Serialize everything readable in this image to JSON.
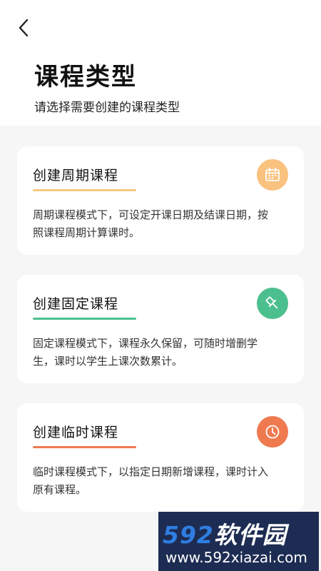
{
  "header": {
    "title": "课程类型",
    "subtitle": "请选择需要创建的课程类型"
  },
  "cards": [
    {
      "title": "创建周期课程",
      "desc": "周期课程模式下，可设定开课日期及结课日期，按照课程周期计算课时。",
      "icon": "calendar-icon",
      "icon_bg": "#f9c27e",
      "underline": "#f3c97e"
    },
    {
      "title": "创建固定课程",
      "desc": "固定课程模式下，课程永久保留，可随时增删学生，课时以学生上课次数累计。",
      "icon": "pin-icon",
      "icon_bg": "#4cbf8e",
      "underline": "#4cbf8e"
    },
    {
      "title": "创建临时课程",
      "desc": "临时课程模式下，以指定日期新增课程，课时计入原有课程。",
      "icon": "clock-icon",
      "icon_bg": "#f07a50",
      "underline": "#ef7a52"
    }
  ],
  "watermark": {
    "brand_num": "592",
    "brand_text": "软件园",
    "url": "www.592xiazai.com"
  }
}
